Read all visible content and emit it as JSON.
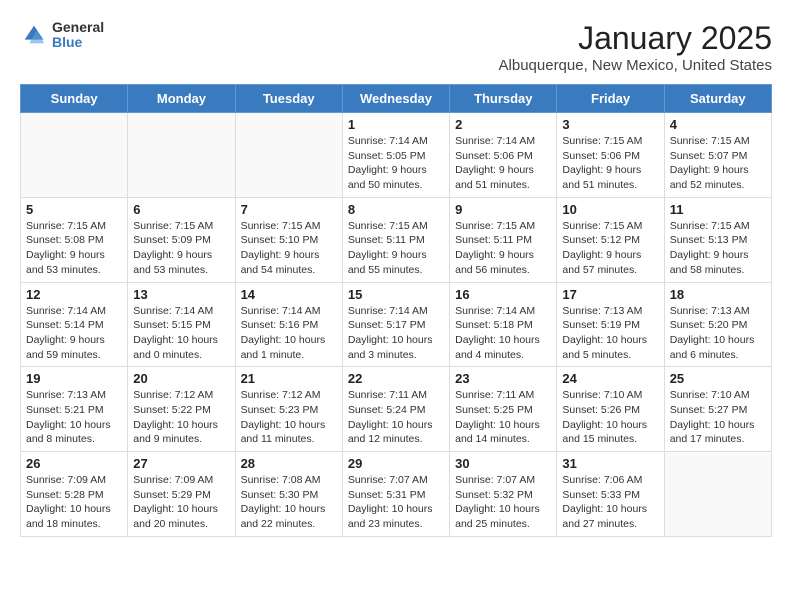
{
  "header": {
    "logo_general": "General",
    "logo_blue": "Blue",
    "title": "January 2025",
    "subtitle": "Albuquerque, New Mexico, United States"
  },
  "days_of_week": [
    "Sunday",
    "Monday",
    "Tuesday",
    "Wednesday",
    "Thursday",
    "Friday",
    "Saturday"
  ],
  "weeks": [
    [
      {
        "day": "",
        "content": ""
      },
      {
        "day": "",
        "content": ""
      },
      {
        "day": "",
        "content": ""
      },
      {
        "day": "1",
        "content": "Sunrise: 7:14 AM\nSunset: 5:05 PM\nDaylight: 9 hours\nand 50 minutes."
      },
      {
        "day": "2",
        "content": "Sunrise: 7:14 AM\nSunset: 5:06 PM\nDaylight: 9 hours\nand 51 minutes."
      },
      {
        "day": "3",
        "content": "Sunrise: 7:15 AM\nSunset: 5:06 PM\nDaylight: 9 hours\nand 51 minutes."
      },
      {
        "day": "4",
        "content": "Sunrise: 7:15 AM\nSunset: 5:07 PM\nDaylight: 9 hours\nand 52 minutes."
      }
    ],
    [
      {
        "day": "5",
        "content": "Sunrise: 7:15 AM\nSunset: 5:08 PM\nDaylight: 9 hours\nand 53 minutes."
      },
      {
        "day": "6",
        "content": "Sunrise: 7:15 AM\nSunset: 5:09 PM\nDaylight: 9 hours\nand 53 minutes."
      },
      {
        "day": "7",
        "content": "Sunrise: 7:15 AM\nSunset: 5:10 PM\nDaylight: 9 hours\nand 54 minutes."
      },
      {
        "day": "8",
        "content": "Sunrise: 7:15 AM\nSunset: 5:11 PM\nDaylight: 9 hours\nand 55 minutes."
      },
      {
        "day": "9",
        "content": "Sunrise: 7:15 AM\nSunset: 5:11 PM\nDaylight: 9 hours\nand 56 minutes."
      },
      {
        "day": "10",
        "content": "Sunrise: 7:15 AM\nSunset: 5:12 PM\nDaylight: 9 hours\nand 57 minutes."
      },
      {
        "day": "11",
        "content": "Sunrise: 7:15 AM\nSunset: 5:13 PM\nDaylight: 9 hours\nand 58 minutes."
      }
    ],
    [
      {
        "day": "12",
        "content": "Sunrise: 7:14 AM\nSunset: 5:14 PM\nDaylight: 9 hours\nand 59 minutes."
      },
      {
        "day": "13",
        "content": "Sunrise: 7:14 AM\nSunset: 5:15 PM\nDaylight: 10 hours\nand 0 minutes."
      },
      {
        "day": "14",
        "content": "Sunrise: 7:14 AM\nSunset: 5:16 PM\nDaylight: 10 hours\nand 1 minute."
      },
      {
        "day": "15",
        "content": "Sunrise: 7:14 AM\nSunset: 5:17 PM\nDaylight: 10 hours\nand 3 minutes."
      },
      {
        "day": "16",
        "content": "Sunrise: 7:14 AM\nSunset: 5:18 PM\nDaylight: 10 hours\nand 4 minutes."
      },
      {
        "day": "17",
        "content": "Sunrise: 7:13 AM\nSunset: 5:19 PM\nDaylight: 10 hours\nand 5 minutes."
      },
      {
        "day": "18",
        "content": "Sunrise: 7:13 AM\nSunset: 5:20 PM\nDaylight: 10 hours\nand 6 minutes."
      }
    ],
    [
      {
        "day": "19",
        "content": "Sunrise: 7:13 AM\nSunset: 5:21 PM\nDaylight: 10 hours\nand 8 minutes."
      },
      {
        "day": "20",
        "content": "Sunrise: 7:12 AM\nSunset: 5:22 PM\nDaylight: 10 hours\nand 9 minutes."
      },
      {
        "day": "21",
        "content": "Sunrise: 7:12 AM\nSunset: 5:23 PM\nDaylight: 10 hours\nand 11 minutes."
      },
      {
        "day": "22",
        "content": "Sunrise: 7:11 AM\nSunset: 5:24 PM\nDaylight: 10 hours\nand 12 minutes."
      },
      {
        "day": "23",
        "content": "Sunrise: 7:11 AM\nSunset: 5:25 PM\nDaylight: 10 hours\nand 14 minutes."
      },
      {
        "day": "24",
        "content": "Sunrise: 7:10 AM\nSunset: 5:26 PM\nDaylight: 10 hours\nand 15 minutes."
      },
      {
        "day": "25",
        "content": "Sunrise: 7:10 AM\nSunset: 5:27 PM\nDaylight: 10 hours\nand 17 minutes."
      }
    ],
    [
      {
        "day": "26",
        "content": "Sunrise: 7:09 AM\nSunset: 5:28 PM\nDaylight: 10 hours\nand 18 minutes."
      },
      {
        "day": "27",
        "content": "Sunrise: 7:09 AM\nSunset: 5:29 PM\nDaylight: 10 hours\nand 20 minutes."
      },
      {
        "day": "28",
        "content": "Sunrise: 7:08 AM\nSunset: 5:30 PM\nDaylight: 10 hours\nand 22 minutes."
      },
      {
        "day": "29",
        "content": "Sunrise: 7:07 AM\nSunset: 5:31 PM\nDaylight: 10 hours\nand 23 minutes."
      },
      {
        "day": "30",
        "content": "Sunrise: 7:07 AM\nSunset: 5:32 PM\nDaylight: 10 hours\nand 25 minutes."
      },
      {
        "day": "31",
        "content": "Sunrise: 7:06 AM\nSunset: 5:33 PM\nDaylight: 10 hours\nand 27 minutes."
      },
      {
        "day": "",
        "content": ""
      }
    ]
  ]
}
